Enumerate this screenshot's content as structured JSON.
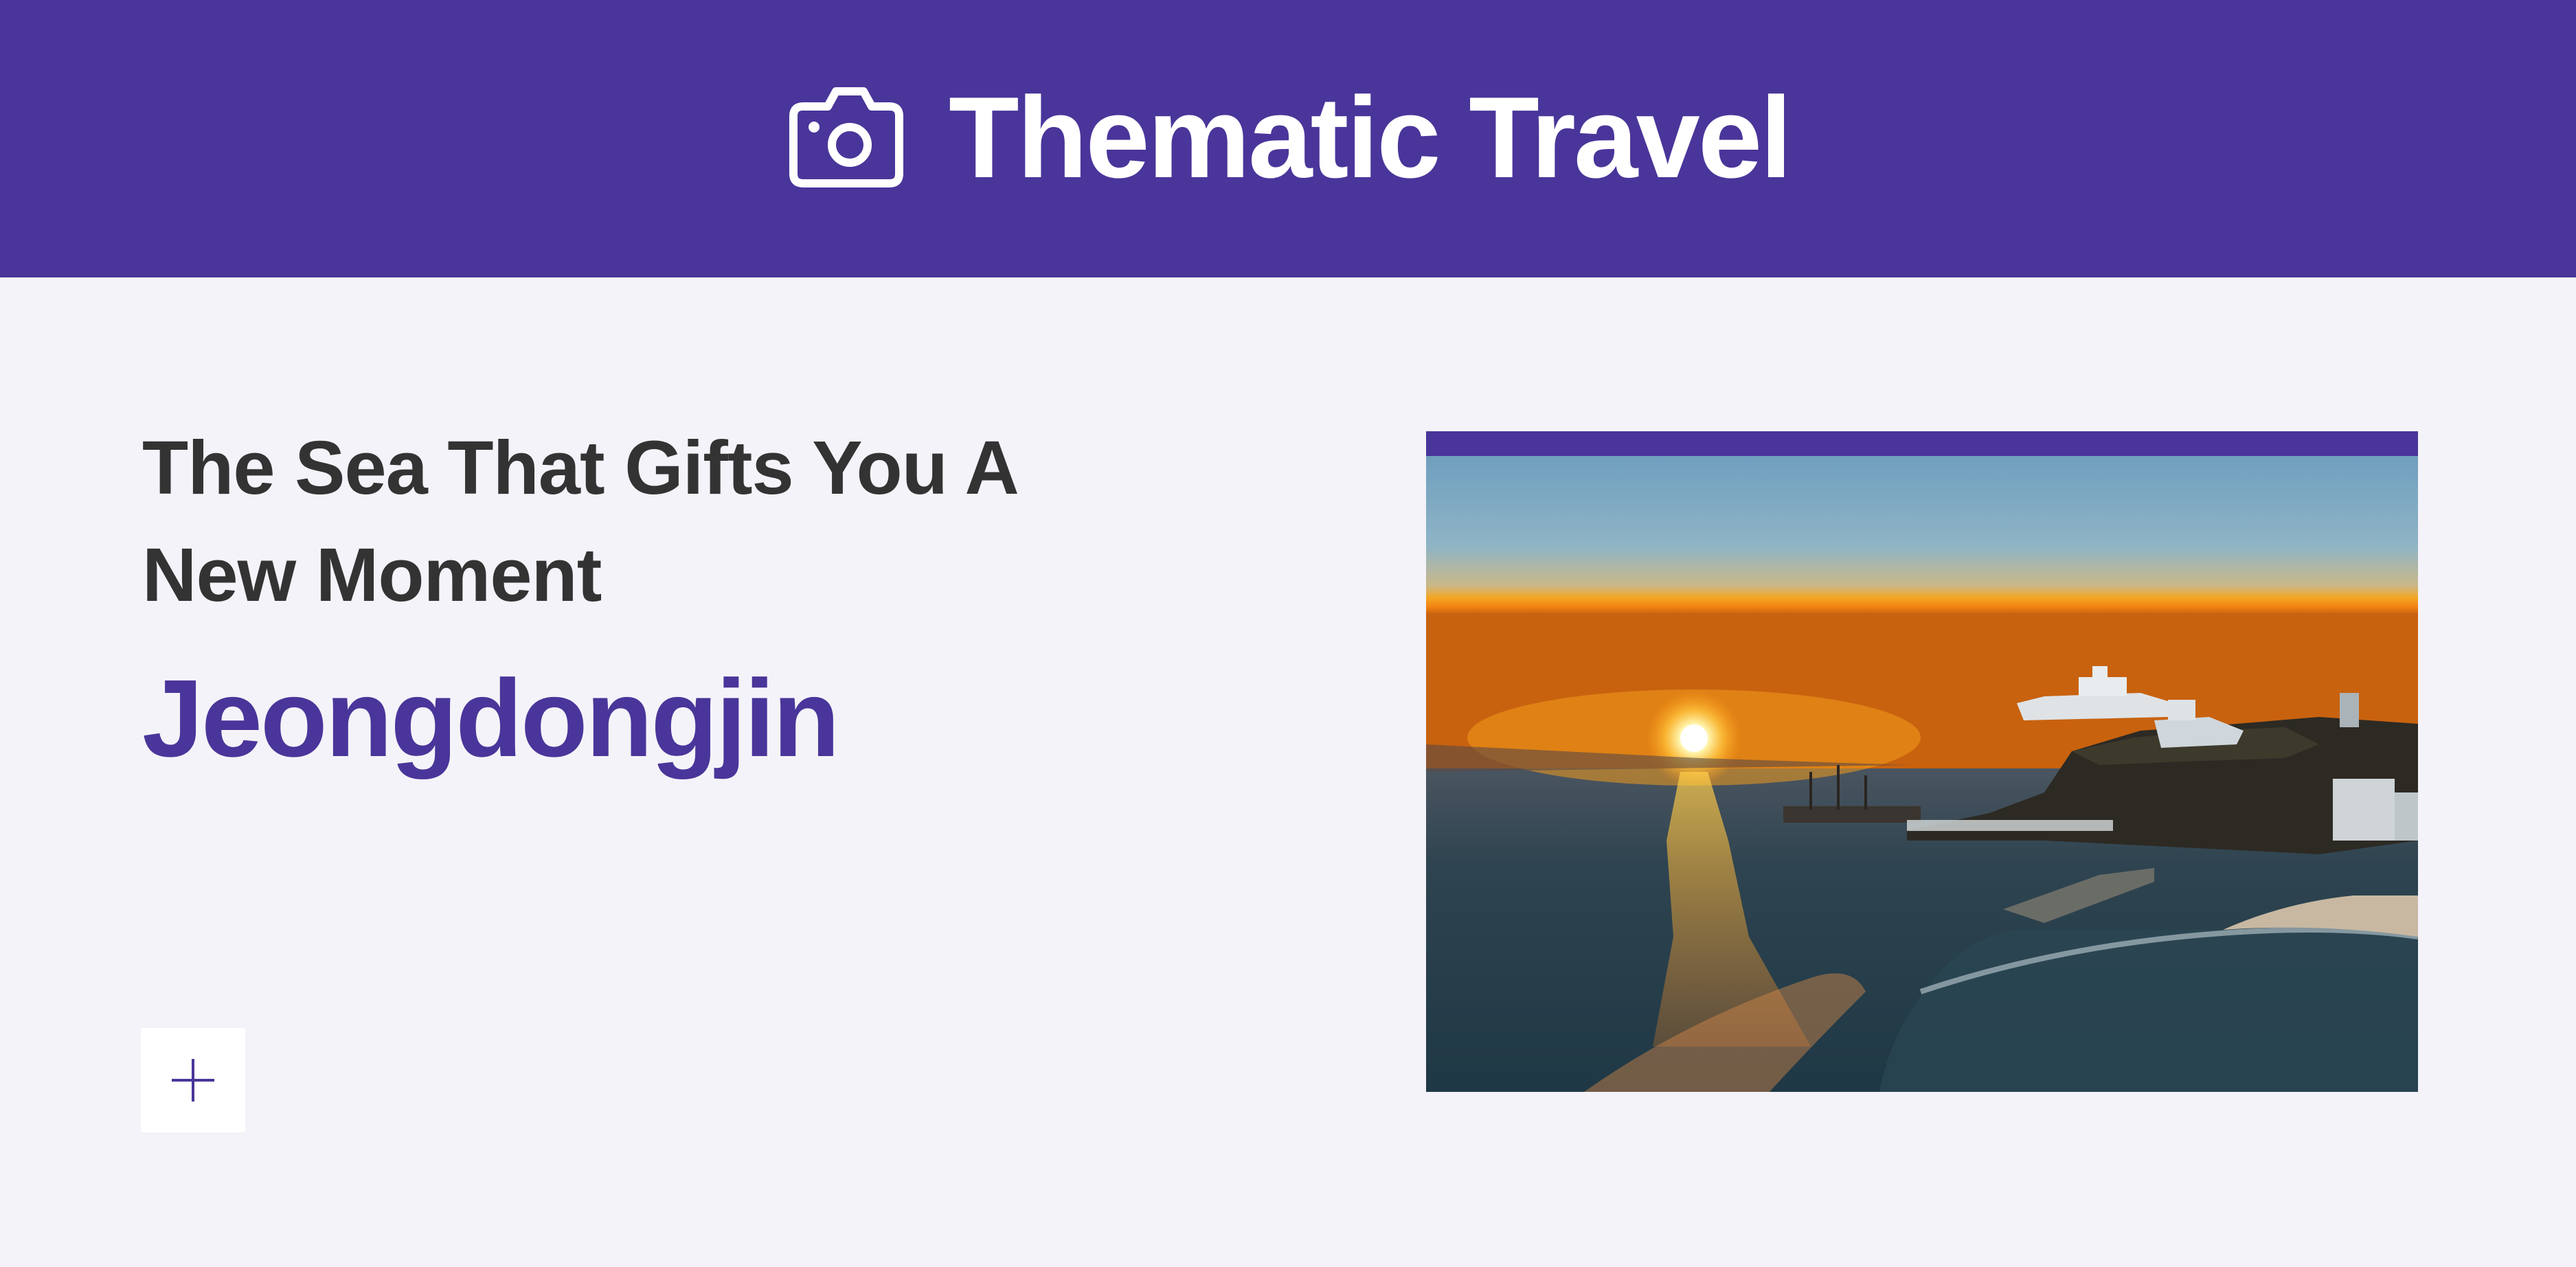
{
  "header": {
    "title": "Thematic Travel",
    "icon": "camera-icon",
    "background_color": "#4a359a"
  },
  "main": {
    "subtitle": "The Sea That Gifts You A New Moment",
    "place_name": "Jeongdongjin",
    "expand_button_icon": "plus-icon",
    "photo": {
      "description_icon": "sunrise-photo"
    }
  },
  "colors": {
    "accent": "#4a359a",
    "page_background": "#f4f3f9",
    "text": "#333333"
  }
}
